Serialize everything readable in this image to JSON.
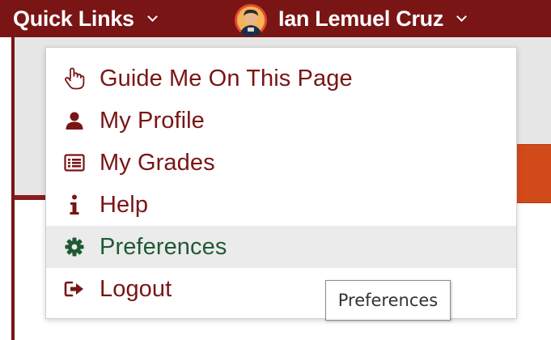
{
  "topbar": {
    "quick_links_label": "Quick Links",
    "user_name": "Ian Lemuel Cruz",
    "background_color": "#7a1515"
  },
  "menu": {
    "items": [
      {
        "label": "Guide Me On This Page",
        "icon": "hand-pointer-icon"
      },
      {
        "label": "My Profile",
        "icon": "user-icon"
      },
      {
        "label": "My Grades",
        "icon": "list-card-icon"
      },
      {
        "label": "Help",
        "icon": "info-icon"
      },
      {
        "label": "Preferences",
        "icon": "gear-icon"
      },
      {
        "label": "Logout",
        "icon": "sign-out-icon"
      }
    ],
    "hovered_item": "Preferences",
    "item_color": "#7a1515",
    "hover_color": "#1f5a34"
  },
  "tooltip": {
    "text": "Preferences"
  }
}
